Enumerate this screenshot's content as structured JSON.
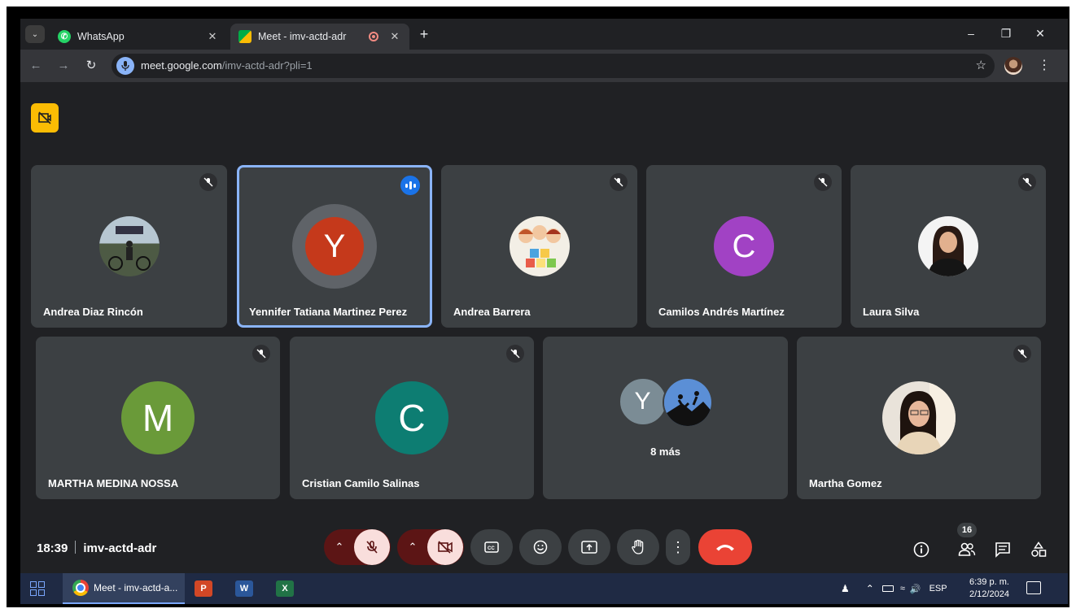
{
  "browser": {
    "tabs": [
      {
        "label": "WhatsApp",
        "active": false
      },
      {
        "label": "Meet - imv-actd-adr",
        "active": true
      }
    ],
    "url_host": "meet.google.com",
    "url_path": "/imv-actd-adr?pli=1"
  },
  "participants_row1": [
    {
      "name": "Andrea Diaz Rincón",
      "initial": "",
      "muted": true
    },
    {
      "name": "Yennifer Tatiana Martinez Perez",
      "initial": "Y",
      "muted": false,
      "speaking": true,
      "avatar_color": "#c5391b"
    },
    {
      "name": "Andrea Barrera",
      "initial": "",
      "muted": true
    },
    {
      "name": "Camilos Andrés Martínez",
      "initial": "C",
      "muted": true,
      "avatar_color": "#a142c4"
    },
    {
      "name": "Laura Silva",
      "initial": "",
      "muted": true
    }
  ],
  "participants_row2": [
    {
      "name": "MARTHA MEDINA NOSSA",
      "initial": "M",
      "muted": true,
      "avatar_color": "#6a9a39"
    },
    {
      "name": "Cristian Camilo Salinas",
      "initial": "C",
      "muted": true,
      "avatar_color": "#0d7d72"
    },
    {
      "name": "",
      "initial": "Y",
      "more_label": "8 más"
    },
    {
      "name": "Martha Gomez",
      "initial": "",
      "muted": true
    }
  ],
  "meeting": {
    "time": "18:39",
    "code": "imv-actd-adr",
    "participant_count": "16"
  },
  "taskbar": {
    "chrome_label": "Meet - imv-actd-a...",
    "ppt_label": "P",
    "word_label": "W",
    "excel_label": "X",
    "lang": "ESP",
    "time": "6:39 p. m.",
    "date": "2/12/2024"
  },
  "colors": {
    "meet_bg": "#202124",
    "tile_bg": "#3c4043",
    "speaking_border": "#8ab4f8",
    "end_call": "#ea4335",
    "muted_ctrl_bg": "#f9dedc"
  }
}
